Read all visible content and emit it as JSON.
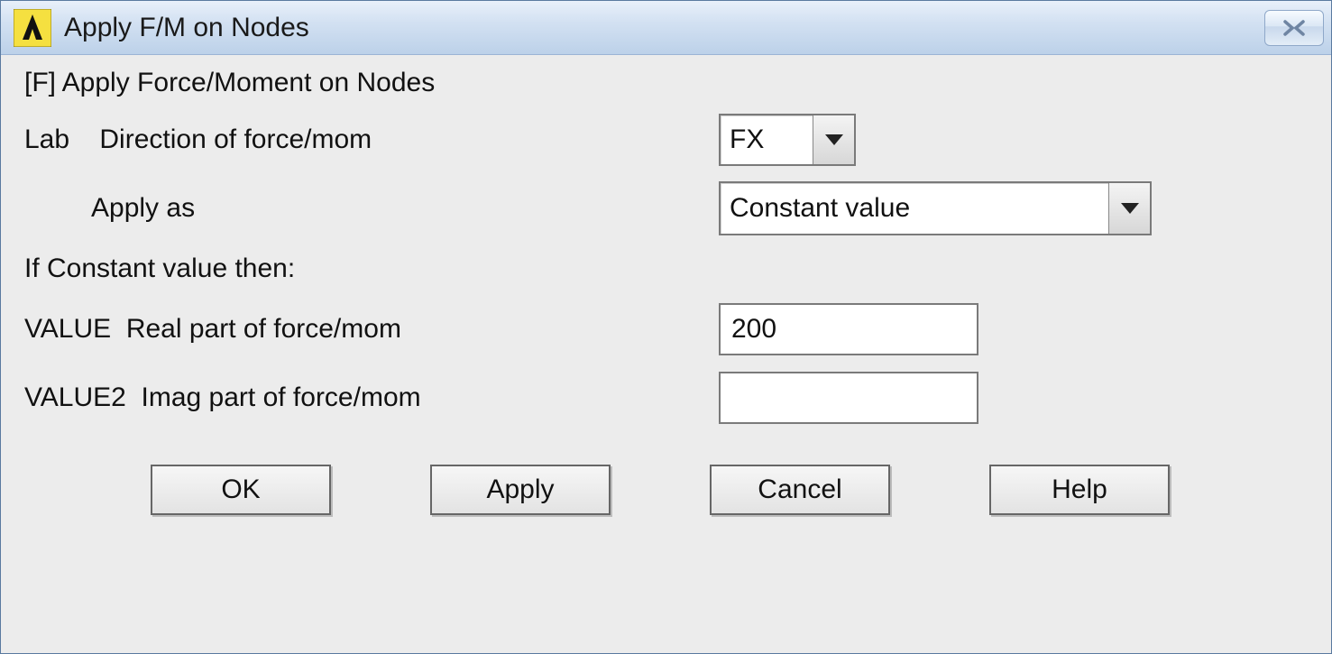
{
  "titlebar": {
    "title": "Apply F/M on Nodes",
    "icon_name": "ansys-logo"
  },
  "form": {
    "heading": "[F]  Apply Force/Moment on Nodes",
    "row_lab": {
      "label": "Lab    Direction of force/mom",
      "dropdown_selected": "FX"
    },
    "row_applyas": {
      "label": "Apply as",
      "dropdown_selected": "Constant value"
    },
    "if_line": "If Constant value then:",
    "row_value": {
      "label": "VALUE  Real part of force/mom",
      "input_value": "200"
    },
    "row_value2": {
      "label": "VALUE2  Imag part of force/mom",
      "input_value": ""
    }
  },
  "buttons": {
    "ok": "OK",
    "apply": "Apply",
    "cancel": "Cancel",
    "help": "Help"
  }
}
